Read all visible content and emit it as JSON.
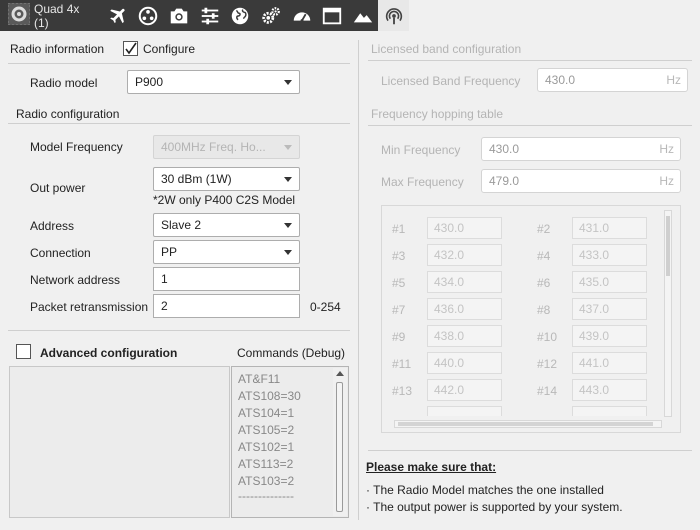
{
  "toolbar": {
    "title": "Quad 4x (1)",
    "icons": [
      "gear-icon",
      "airplane-icon",
      "sensor-icon",
      "camera-icon",
      "sliders-icon",
      "globe-icon",
      "gears-icon",
      "gauge-icon",
      "window-icon",
      "mountain-icon",
      "radio-icon"
    ]
  },
  "radio": {
    "info_label": "Radio information",
    "configure_label": "Configure",
    "configure_checked": true,
    "model_label": "Radio model",
    "model_value": "P900",
    "config_section": "Radio configuration",
    "model_freq_label": "Model Frequency",
    "model_freq_value": "400MHz Freq. Ho...",
    "out_power_label": "Out power",
    "out_power_value": "30 dBm (1W)",
    "out_power_note": "*2W only P400 C2S Model",
    "address_label": "Address",
    "address_value": "Slave 2",
    "connection_label": "Connection",
    "connection_value": "PP",
    "network_label": "Network address",
    "network_value": "1",
    "packet_label": "Packet retransmission",
    "packet_value": "2",
    "packet_range": "0-254"
  },
  "advanced": {
    "label": "Advanced configuration",
    "checked": false,
    "commands_label": "Commands (Debug)",
    "commands": [
      "AT&F11",
      "ATS108=30",
      "ATS104=1",
      "ATS105=2",
      "ATS102=1",
      "ATS113=2",
      "ATS103=2",
      "--------------"
    ]
  },
  "licensed": {
    "section": "Licensed band configuration",
    "freq_label": "Licensed Band Frequency",
    "freq_value": "430.0",
    "unit": "Hz"
  },
  "hopping": {
    "section": "Frequency hopping table",
    "min_label": "Min Frequency",
    "min_value": "430.0",
    "max_label": "Max Frequency",
    "max_value": "479.0",
    "unit": "Hz",
    "rows": [
      {
        "l1": "#1",
        "v1": "430.0",
        "l2": "#2",
        "v2": "431.0"
      },
      {
        "l1": "#3",
        "v1": "432.0",
        "l2": "#4",
        "v2": "433.0"
      },
      {
        "l1": "#5",
        "v1": "434.0",
        "l2": "#6",
        "v2": "435.0"
      },
      {
        "l1": "#7",
        "v1": "436.0",
        "l2": "#8",
        "v2": "437.0"
      },
      {
        "l1": "#9",
        "v1": "438.0",
        "l2": "#10",
        "v2": "439.0"
      },
      {
        "l1": "#11",
        "v1": "440.0",
        "l2": "#12",
        "v2": "441.0"
      },
      {
        "l1": "#13",
        "v1": "442.0",
        "l2": "#14",
        "v2": "443.0"
      }
    ]
  },
  "notice": {
    "title": "Please make sure that:",
    "items": [
      "· The Radio Model matches the one installed",
      "· The output power is supported by your system."
    ]
  }
}
